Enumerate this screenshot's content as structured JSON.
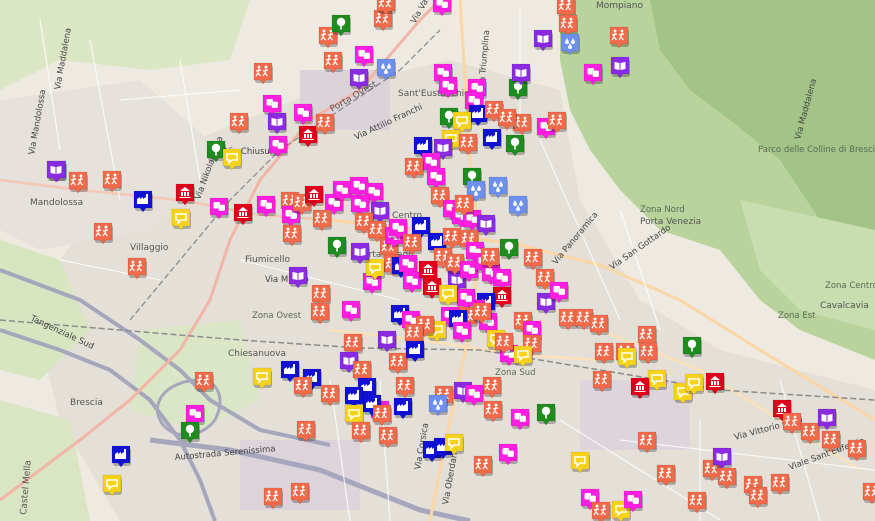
{
  "map": {
    "colors": {
      "background": "#eeeae2",
      "urban": "#e2ddd4",
      "green": "#cfe3b4",
      "hills": "#a9c98e",
      "industrial": "#e0d5e0",
      "motorway": "#a6a6bd",
      "trunk": "#f2b5a6",
      "primary": "#fcd6a4",
      "railway": "#8c8c8c",
      "marker_shadow": "rgba(0,0,0,0.25)"
    },
    "categories": [
      {
        "key": "sport",
        "color": "#f16a4a",
        "icon": "people-running-icon"
      },
      {
        "key": "theatre",
        "color": "#ff1ee1",
        "icon": "theatre-masks-icon"
      },
      {
        "key": "library",
        "color": "#8a2be2",
        "icon": "open-book-icon"
      },
      {
        "key": "factory",
        "color": "#1111d6",
        "icon": "factory-icon"
      },
      {
        "key": "chat",
        "color": "#f7d21b",
        "icon": "speech-bubble-icon"
      },
      {
        "key": "park",
        "color": "#1e8c1e",
        "icon": "tree-icon"
      },
      {
        "key": "monument",
        "color": "#e0001b",
        "icon": "monument-icon"
      },
      {
        "key": "water",
        "color": "#6c8ff0",
        "icon": "water-drops-icon"
      }
    ],
    "labels": [
      "Via Mandolossa",
      "Via Maddalena",
      "Mandolossa",
      "Villaggio",
      "Fiumicello",
      "Porta Ovest",
      "Sant'Eustacchio",
      "Via Attilio Franchi",
      "Centro",
      "Porta Milano",
      "Zona Ovest",
      "Chiesanuova",
      "Zona Sud",
      "Via Panoramica",
      "Via San Gottardo",
      "Zona Nord",
      "Porta Venezia",
      "Parco delle Colline di Brescia",
      "Via Maddalena",
      "Zona Centro",
      "Zona Est",
      "Cavalcavia",
      "Viale Sant'Eufemia",
      "Via Vittorio Gatti",
      "Tangenziale Sud",
      "Autostrada Serenissima",
      "Via Oberdan",
      "Brescia",
      "Mompiano",
      "Via Triumplina",
      "Via Milano",
      "Via Chiusure",
      "Via Valcamonica",
      "Via Nikolajewka",
      "Via Corsica",
      "Castel Mella"
    ],
    "markers": [
      [
        "sport",
        328,
        36
      ],
      [
        "sport",
        383,
        19
      ],
      [
        "sport",
        386,
        3
      ],
      [
        "theatre",
        364,
        55
      ],
      [
        "park",
        341,
        24
      ],
      [
        "library",
        359,
        78
      ],
      [
        "water",
        386,
        68
      ],
      [
        "sport",
        333,
        61
      ],
      [
        "sport",
        263,
        72
      ],
      [
        "theatre",
        442,
        4
      ],
      [
        "sport",
        566,
        6
      ],
      [
        "sport",
        568,
        24
      ],
      [
        "library",
        543,
        39
      ],
      [
        "water",
        570,
        43
      ],
      [
        "sport",
        619,
        36
      ],
      [
        "theatre",
        593,
        73
      ],
      [
        "library",
        620,
        66
      ],
      [
        "theatre",
        443,
        73
      ],
      [
        "park",
        518,
        88
      ],
      [
        "library",
        521,
        73
      ],
      [
        "theatre",
        448,
        86
      ],
      [
        "theatre",
        477,
        88
      ],
      [
        "park",
        449,
        117
      ],
      [
        "theatre",
        474,
        101
      ],
      [
        "factory",
        478,
        114
      ],
      [
        "chat",
        462,
        121
      ],
      [
        "chat",
        451,
        139
      ],
      [
        "sport",
        494,
        110
      ],
      [
        "sport",
        522,
        123
      ],
      [
        "theatre",
        546,
        127
      ],
      [
        "sport",
        557,
        121
      ],
      [
        "sport",
        507,
        118
      ],
      [
        "park",
        515,
        144
      ],
      [
        "factory",
        492,
        138
      ],
      [
        "sport",
        468,
        143
      ],
      [
        "theatre",
        272,
        104
      ],
      [
        "library",
        277,
        122
      ],
      [
        "theatre",
        303,
        113
      ],
      [
        "sport",
        239,
        122
      ],
      [
        "monument",
        308,
        135
      ],
      [
        "sport",
        325,
        123
      ],
      [
        "theatre",
        278,
        145
      ],
      [
        "park",
        216,
        150
      ],
      [
        "chat",
        232,
        158
      ],
      [
        "factory",
        423,
        146
      ],
      [
        "library",
        443,
        148
      ],
      [
        "theatre",
        431,
        162
      ],
      [
        "sport",
        414,
        167
      ],
      [
        "theatre",
        436,
        177
      ],
      [
        "sport",
        440,
        196
      ],
      [
        "park",
        472,
        177
      ],
      [
        "water",
        476,
        190
      ],
      [
        "water",
        498,
        186
      ],
      [
        "water",
        518,
        205
      ],
      [
        "theatre",
        57,
        170
      ],
      [
        "library",
        56,
        170
      ],
      [
        "sport",
        78,
        181
      ],
      [
        "sport",
        112,
        180
      ],
      [
        "factory",
        143,
        200
      ],
      [
        "monument",
        185,
        193
      ],
      [
        "theatre",
        219,
        207
      ],
      [
        "chat",
        181,
        218
      ],
      [
        "monument",
        243,
        213
      ],
      [
        "theatre",
        266,
        205
      ],
      [
        "sport",
        290,
        201
      ],
      [
        "theatre",
        291,
        215
      ],
      [
        "sport",
        302,
        203
      ],
      [
        "monument",
        314,
        195
      ],
      [
        "theatre",
        334,
        203
      ],
      [
        "theatre",
        342,
        190
      ],
      [
        "theatre",
        359,
        186
      ],
      [
        "theatre",
        374,
        192
      ],
      [
        "theatre",
        360,
        204
      ],
      [
        "sport",
        322,
        219
      ],
      [
        "library",
        380,
        211
      ],
      [
        "sport",
        364,
        222
      ],
      [
        "theatre",
        452,
        209
      ],
      [
        "theatre",
        461,
        216
      ],
      [
        "theatre",
        472,
        219
      ],
      [
        "sport",
        464,
        204
      ],
      [
        "library",
        486,
        224
      ],
      [
        "sport",
        103,
        232
      ],
      [
        "sport",
        137,
        267
      ],
      [
        "sport",
        292,
        234
      ],
      [
        "sport",
        377,
        230
      ],
      [
        "sport",
        389,
        247
      ],
      [
        "theatre",
        394,
        236
      ],
      [
        "theatre",
        398,
        228
      ],
      [
        "factory",
        421,
        226
      ],
      [
        "factory",
        437,
        242
      ],
      [
        "sport",
        452,
        237
      ],
      [
        "sport",
        469,
        239
      ],
      [
        "theatre",
        475,
        251
      ],
      [
        "sport",
        443,
        257
      ],
      [
        "park",
        337,
        246
      ],
      [
        "sport",
        412,
        243
      ],
      [
        "sport",
        393,
        264
      ],
      [
        "factory",
        401,
        266
      ],
      [
        "theatre",
        408,
        264
      ],
      [
        "theatre",
        412,
        281
      ],
      [
        "monument",
        428,
        270
      ],
      [
        "monument",
        432,
        287
      ],
      [
        "library",
        457,
        280
      ],
      [
        "sport",
        455,
        263
      ],
      [
        "theatre",
        469,
        270
      ],
      [
        "theatre",
        484,
        262
      ],
      [
        "theatre",
        491,
        273
      ],
      [
        "theatre",
        502,
        278
      ],
      [
        "sport",
        490,
        257
      ],
      [
        "park",
        509,
        248
      ],
      [
        "library",
        298,
        276
      ],
      [
        "theatre",
        372,
        282
      ],
      [
        "chat",
        375,
        268
      ],
      [
        "sport",
        321,
        294
      ],
      [
        "sport",
        320,
        312
      ],
      [
        "library",
        360,
        252
      ],
      [
        "sport",
        533,
        258
      ],
      [
        "sport",
        545,
        278
      ],
      [
        "library",
        546,
        302
      ],
      [
        "theatre",
        559,
        291
      ],
      [
        "monument",
        502,
        296
      ],
      [
        "factory",
        486,
        302
      ],
      [
        "theatre",
        476,
        309
      ],
      [
        "theatre",
        466,
        298
      ],
      [
        "chat",
        448,
        294
      ],
      [
        "sport",
        468,
        316
      ],
      [
        "theatre",
        450,
        316
      ],
      [
        "factory",
        458,
        319
      ],
      [
        "theatre",
        488,
        322
      ],
      [
        "sport",
        482,
        312
      ],
      [
        "theatre",
        351,
        310
      ],
      [
        "factory",
        400,
        314
      ],
      [
        "theatre",
        411,
        320
      ],
      [
        "chat",
        437,
        330
      ],
      [
        "theatre",
        462,
        331
      ],
      [
        "sport",
        425,
        325
      ],
      [
        "sport",
        414,
        333
      ],
      [
        "chat",
        496,
        339
      ],
      [
        "sport",
        523,
        321
      ],
      [
        "theatre",
        532,
        330
      ],
      [
        "sport",
        532,
        344
      ],
      [
        "theatre",
        509,
        354
      ],
      [
        "chat",
        523,
        355
      ],
      [
        "sport",
        504,
        342
      ],
      [
        "sport",
        568,
        318
      ],
      [
        "sport",
        584,
        318
      ],
      [
        "sport",
        599,
        324
      ],
      [
        "library",
        387,
        340
      ],
      [
        "sport",
        353,
        343
      ],
      [
        "library",
        349,
        361
      ],
      [
        "sport",
        362,
        370
      ],
      [
        "sport",
        398,
        362
      ],
      [
        "factory",
        415,
        350
      ],
      [
        "sport",
        604,
        352
      ],
      [
        "sport",
        625,
        352
      ],
      [
        "chat",
        627,
        357
      ],
      [
        "sport",
        647,
        335
      ],
      [
        "sport",
        648,
        352
      ],
      [
        "park",
        692,
        346
      ],
      [
        "sport",
        204,
        381
      ],
      [
        "chat",
        262,
        377
      ],
      [
        "factory",
        290,
        370
      ],
      [
        "factory",
        312,
        378
      ],
      [
        "sport",
        303,
        386
      ],
      [
        "sport",
        330,
        394
      ],
      [
        "factory",
        367,
        387
      ],
      [
        "factory",
        354,
        396
      ],
      [
        "sport",
        405,
        386
      ],
      [
        "library",
        463,
        391
      ],
      [
        "sport",
        492,
        386
      ],
      [
        "sport",
        493,
        410
      ],
      [
        "theatre",
        474,
        394
      ],
      [
        "sport",
        444,
        395
      ],
      [
        "water",
        438,
        404
      ],
      [
        "theatre",
        380,
        410
      ],
      [
        "factory",
        403,
        407
      ],
      [
        "factory",
        372,
        404
      ],
      [
        "chat",
        354,
        414
      ],
      [
        "theatre",
        520,
        418
      ],
      [
        "park",
        546,
        413
      ],
      [
        "theatre",
        195,
        414
      ],
      [
        "park",
        190,
        431
      ],
      [
        "sport",
        306,
        430
      ],
      [
        "sport",
        361,
        431
      ],
      [
        "sport",
        388,
        436
      ],
      [
        "sport",
        382,
        414
      ],
      [
        "factory",
        432,
        450
      ],
      [
        "factory",
        443,
        447
      ],
      [
        "chat",
        454,
        443
      ],
      [
        "theatre",
        508,
        453
      ],
      [
        "sport",
        483,
        465
      ],
      [
        "chat",
        580,
        461
      ],
      [
        "sport",
        602,
        380
      ],
      [
        "chat",
        657,
        379
      ],
      [
        "monument",
        640,
        387
      ],
      [
        "chat",
        683,
        392
      ],
      [
        "chat",
        694,
        383
      ],
      [
        "monument",
        715,
        382
      ],
      [
        "sport",
        647,
        441
      ],
      [
        "sport",
        666,
        474
      ],
      [
        "sport",
        712,
        469
      ],
      [
        "library",
        722,
        457
      ],
      [
        "sport",
        727,
        477
      ],
      [
        "sport",
        780,
        483
      ],
      [
        "sport",
        753,
        485
      ],
      [
        "sport",
        697,
        501
      ],
      [
        "sport",
        758,
        496
      ],
      [
        "monument",
        782,
        409
      ],
      [
        "sport",
        792,
        422
      ],
      [
        "sport",
        810,
        432
      ],
      [
        "library",
        827,
        418
      ],
      [
        "sport",
        831,
        440
      ],
      [
        "sport",
        857,
        449
      ],
      [
        "sport",
        872,
        492
      ],
      [
        "theatre",
        590,
        498
      ],
      [
        "sport",
        601,
        511
      ],
      [
        "chat",
        621,
        510
      ],
      [
        "theatre",
        633,
        500
      ],
      [
        "sport",
        273,
        497
      ],
      [
        "sport",
        300,
        492
      ],
      [
        "chat",
        112,
        484
      ],
      [
        "factory",
        121,
        455
      ]
    ]
  }
}
